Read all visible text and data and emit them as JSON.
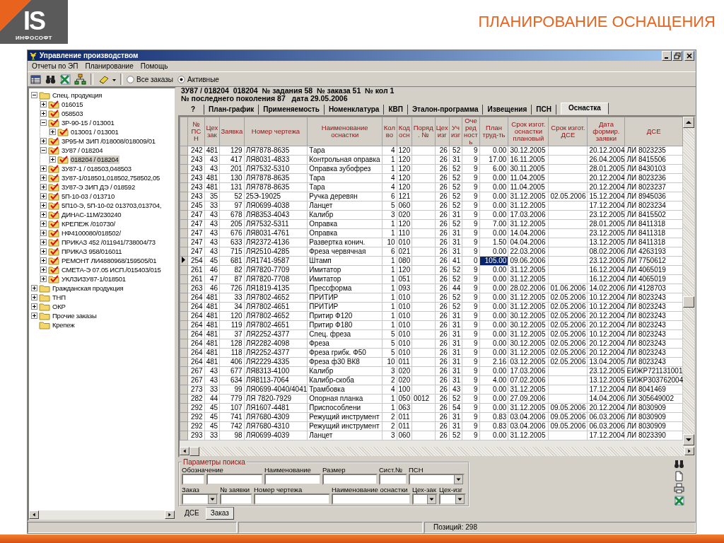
{
  "logo": {
    "mark": "IS",
    "name": "ИНФОСОФТ"
  },
  "page_title": "ПЛАНИРОВАНИЕ ОСНАЩЕНИЯ",
  "window": {
    "title": "Управление производством"
  },
  "menu": [
    "Отчеты по ЭП",
    "Планирование",
    "Помощь"
  ],
  "toolbar": {
    "filters": [
      {
        "label": "Все заказы",
        "selected": false
      },
      {
        "label": "Активные",
        "selected": true
      }
    ]
  },
  "tree": {
    "items": [
      {
        "label": "Спец. продукция",
        "kind": "folder",
        "expanded": true,
        "selected": false,
        "children": [
          {
            "label": "016015",
            "kind": "order",
            "expanded": false,
            "selected": false
          },
          {
            "label": "058503",
            "kind": "order",
            "expanded": false,
            "selected": false
          },
          {
            "label": "3Р-90-15 / 013001",
            "kind": "order",
            "expanded": true,
            "selected": false,
            "children": [
              {
                "label": "013001 / 013001",
                "kind": "order",
                "expanded": false,
                "selected": false
              }
            ]
          },
          {
            "label": "3Р95-М ЗИП /018008/018009/01",
            "kind": "order",
            "expanded": false,
            "selected": false
          },
          {
            "label": "3У87 / 018204",
            "kind": "order",
            "expanded": true,
            "selected": false,
            "children": [
              {
                "label": "018204 / 018204",
                "kind": "order",
                "expanded": false,
                "selected": true
              }
            ]
          },
          {
            "label": "3У87-1 / 018503,048503",
            "kind": "order",
            "expanded": false,
            "selected": false
          },
          {
            "label": "3У87-1/018501,018502,758502,05",
            "kind": "order",
            "expanded": false,
            "selected": false
          },
          {
            "label": "3У87-Э ЗИП ДЭ / 018592",
            "kind": "order",
            "expanded": false,
            "selected": false
          },
          {
            "label": "5П-10-03 / 013710",
            "kind": "order",
            "expanded": false,
            "selected": false
          },
          {
            "label": "5П10-Э, 5П-10-02 013703,013704,",
            "kind": "order",
            "expanded": false,
            "selected": false
          },
          {
            "label": "ДИНАС-11М/230240",
            "kind": "order",
            "expanded": false,
            "selected": false
          },
          {
            "label": "КРЕПЕЖ /010730/",
            "kind": "order",
            "expanded": false,
            "selected": false
          },
          {
            "label": "НФ4100080/018502/",
            "kind": "order",
            "expanded": false,
            "selected": false
          },
          {
            "label": "ПРИКАЗ 452 /011941/738004/73",
            "kind": "order",
            "expanded": false,
            "selected": false
          },
          {
            "label": "ПРИКАЗ 958/016011",
            "kind": "order",
            "expanded": false,
            "selected": false
          },
          {
            "label": "РЕМОНТ ЛИ4880968/159505/01",
            "kind": "order",
            "expanded": false,
            "selected": false
          },
          {
            "label": "СМЕТА-Э 07.05 ИСП./015403/015",
            "kind": "order",
            "expanded": false,
            "selected": false
          },
          {
            "label": "УКЛЗИЗУ87-1/018501",
            "kind": "order",
            "expanded": false,
            "selected": false
          }
        ]
      },
      {
        "label": "Гражданская продукция",
        "kind": "folder",
        "expanded": false,
        "selected": false
      },
      {
        "label": "ТНП",
        "kind": "folder",
        "expanded": false,
        "selected": false
      },
      {
        "label": "ОКР",
        "kind": "folder",
        "expanded": false,
        "selected": false
      },
      {
        "label": "Прочие заказы",
        "kind": "folder",
        "expanded": false,
        "selected": false
      },
      {
        "label": "Крепеж",
        "kind": "folder",
        "selected": false
      }
    ]
  },
  "info_lines": [
    "3У87 / 018204  018204  № задания 58  № заказа 51  № кол 1",
    "№ последнего поколения 87   дата 29.05.2006"
  ],
  "tabs": [
    {
      "label": "?",
      "selected": false
    },
    {
      "label": "План-график",
      "selected": false
    },
    {
      "label": "Применяемость",
      "selected": false
    },
    {
      "label": "Номенклатура",
      "selected": false
    },
    {
      "label": "КВП",
      "selected": false
    },
    {
      "label": "Эталон-программа",
      "selected": false
    },
    {
      "label": "Извещения",
      "selected": false
    },
    {
      "label": "ПСН",
      "selected": false
    },
    {
      "label": "Оснастка",
      "selected": true
    }
  ],
  "table": {
    "columns": [
      "№ ПСН",
      "Цех зак",
      "Заявка",
      "Номер чертежа",
      "Наименование оснастки",
      "Кол во",
      "Код осн",
      "Поряд. №",
      "Цех изг",
      "Уч изг",
      "Оче ред ность",
      "План труд-ть",
      "Срок изгот. оснастки плановый",
      "Срок изгот. ДСЕ",
      "Дата формир. заявки",
      "ДСЕ"
    ],
    "rows": [
      {
        "selected": false,
        "cells": [
          "242",
          "481",
          "129",
          "ЛЯ7878-8635",
          "Тара",
          "4",
          "120",
          null,
          "26",
          "52",
          "9",
          "0.00",
          "30.12.2005",
          null,
          "20.12.2004",
          "ЛИ 8023235"
        ]
      },
      {
        "selected": false,
        "cells": [
          "243",
          "43",
          "417",
          "ЛЯ8031-4833",
          "Контрольная оправка",
          "1",
          "120",
          null,
          "26",
          "31",
          "9",
          "17.00",
          "16.11.2005",
          null,
          "26.04.2005",
          "ЛИ 8415506"
        ]
      },
      {
        "selected": false,
        "cells": [
          "243",
          "43",
          "201",
          "ЛЯ7532-5310",
          "Оправка зубофрез",
          "1",
          "120",
          null,
          "26",
          "52",
          "9",
          "6.00",
          "30.11.2005",
          null,
          "28.01.2005",
          "ЛИ 8430103"
        ]
      },
      {
        "selected": false,
        "cells": [
          "243",
          "481",
          "130",
          "ЛЯ7878-8635",
          "Тара",
          "4",
          "120",
          null,
          "26",
          "52",
          "9",
          "0.00",
          "11.04.2005",
          null,
          "20.12.2004",
          "ЛИ 8023236"
        ]
      },
      {
        "selected": false,
        "cells": [
          "243",
          "481",
          "131",
          "ЛЯ7878-8635",
          "Тара",
          "4",
          "120",
          null,
          "26",
          "52",
          "9",
          "0.00",
          "11.04.2005",
          null,
          "20.12.2004",
          "ЛИ 8023237"
        ]
      },
      {
        "selected": false,
        "cells": [
          "243",
          "35",
          "52",
          "25Э-19025",
          "Ручка деревян",
          "6",
          "121",
          null,
          "26",
          "52",
          "9",
          "0.00",
          "31.12.2005",
          "02.05.2006",
          "15.12.2004",
          "ЛИ 8945036"
        ]
      },
      {
        "selected": false,
        "cells": [
          "245",
          "33",
          "97",
          "ЛЯ0699-4038",
          "Ланцет",
          "5",
          "060",
          null,
          "26",
          "52",
          "9",
          "0.00",
          "31.12.2005",
          null,
          "17.12.2004",
          "ЛИ 8023234"
        ]
      },
      {
        "selected": false,
        "cells": [
          "247",
          "43",
          "678",
          "ЛЯ8353-4043",
          "Калибр",
          "3",
          "020",
          null,
          "26",
          "31",
          "9",
          "0.00",
          "17.03.2006",
          null,
          "23.12.2005",
          "ЛИ 8415502"
        ]
      },
      {
        "selected": false,
        "cells": [
          "247",
          "43",
          "205",
          "ЛЯ7532-5311",
          "Оправка",
          "1",
          "120",
          null,
          "26",
          "52",
          "9",
          "7.00",
          "31.12.2005",
          null,
          "28.01.2005",
          "ЛИ 8411318"
        ]
      },
      {
        "selected": false,
        "cells": [
          "247",
          "43",
          "676",
          "ЛЯ8031-4761",
          "Оправка",
          "1",
          "110",
          null,
          "26",
          "31",
          "9",
          "0.00",
          "14.04.2006",
          null,
          "23.12.2005",
          "ЛИ 8411318"
        ]
      },
      {
        "selected": false,
        "cells": [
          "247",
          "43",
          "633",
          "ЛЯ2372-4136",
          "Развертка  конич.",
          "10",
          "010",
          null,
          "26",
          "31",
          "9",
          "1.50",
          "04.04.2006",
          null,
          "13.12.2005",
          "ЛИ 8411318"
        ]
      },
      {
        "selected": false,
        "cells": [
          "247",
          "43",
          "715",
          "ЛЯ2510-4285",
          "Фреза червячная",
          "6",
          "021",
          null,
          "26",
          "31",
          "9",
          "0.00",
          "22.03.2006",
          null,
          "08.02.2006",
          "ЛИ 4263193"
        ]
      },
      {
        "selected": true,
        "cells": [
          "254",
          "45",
          "681",
          "ЛЯ1741-9587",
          "Штамп",
          "1",
          "080",
          null,
          "26",
          "41",
          "0",
          {
            "text": "105.00",
            "selected": true
          },
          "09.06.2006",
          null,
          "23.12.2005",
          "ЛИ 7750612"
        ]
      },
      {
        "selected": false,
        "cells": [
          "261",
          "46",
          "82",
          "ЛЯ7820-7709",
          "Имитатор",
          "1",
          "120",
          null,
          "26",
          "52",
          "9",
          "0.00",
          "31.12.2005",
          null,
          "16.12.2004",
          "ЛИ 4065019"
        ]
      },
      {
        "selected": false,
        "cells": [
          "261",
          "47",
          "87",
          "ЛЯ7820-7708",
          "Имитатор",
          "1",
          "051",
          null,
          "26",
          "52",
          "9",
          "0.00",
          "31.12.2005",
          null,
          "16.12.2004",
          "ЛИ 4065019"
        ]
      },
      {
        "selected": false,
        "cells": [
          "263",
          "46",
          "726",
          "ЛЯ1819-4135",
          "Прессформа",
          "1",
          "093",
          null,
          "26",
          "44",
          "9",
          "0.00",
          "28.02.2006",
          "01.06.2006",
          "14.02.2006",
          "ЛИ 4128703"
        ]
      },
      {
        "selected": false,
        "cells": [
          "264",
          "481",
          "33",
          "ЛЯ7802-4652",
          "ПРИТИР",
          "1",
          "010",
          null,
          "26",
          "52",
          "9",
          "0.00",
          "31.12.2005",
          "02.05.2006",
          "10.12.2004",
          "ЛИ 8023243"
        ]
      },
      {
        "selected": false,
        "cells": [
          "264",
          "481",
          "34",
          "ЛЯ7802-4651",
          "ПРИТИР",
          "1",
          "010",
          null,
          "26",
          "52",
          "9",
          "0.00",
          "31.12.2005",
          "02.05.2006",
          "10.12.2004",
          "ЛИ 8023243"
        ]
      },
      {
        "selected": false,
        "cells": [
          "264",
          "481",
          "120",
          "ЛЯ7802-4652",
          "Притир Ф120",
          "1",
          "010",
          null,
          "26",
          "31",
          "9",
          "0.00",
          "30.12.2005",
          "02.05.2006",
          "20.12.2004",
          "ЛИ 8023243"
        ]
      },
      {
        "selected": false,
        "cells": [
          "264",
          "481",
          "119",
          "ЛЯ7802-4651",
          "Притир Ф180",
          "1",
          "010",
          null,
          "26",
          "31",
          "9",
          "0.00",
          "30.12.2005",
          "02.05.2006",
          "20.12.2004",
          "ЛИ 8023243"
        ]
      },
      {
        "selected": false,
        "cells": [
          "264",
          "481",
          "37",
          "ЛЯ2252-4377",
          "Спец. фреза",
          "5",
          "010",
          null,
          "26",
          "31",
          "9",
          "0.00",
          "31.12.2005",
          "02.05.2006",
          "10.12.2004",
          "ЛИ 8023243"
        ]
      },
      {
        "selected": false,
        "cells": [
          "264",
          "481",
          "128",
          "ЛЯ2282-4098",
          "Фреза",
          "5",
          "010",
          null,
          "26",
          "31",
          "9",
          "0.00",
          "30.12.2005",
          "02.05.2006",
          "20.12.2004",
          "ЛИ 8023243"
        ]
      },
      {
        "selected": false,
        "cells": [
          "264",
          "481",
          "118",
          "ЛЯ2252-4377",
          "Фреза грибк. Ф50",
          "5",
          "010",
          null,
          "26",
          "31",
          "9",
          "0.00",
          "31.12.2005",
          "02.05.2006",
          "20.12.2004",
          "ЛИ 8023243"
        ]
      },
      {
        "selected": false,
        "cells": [
          "264",
          "481",
          "406",
          "ЛЯ2229-4335",
          "Фреза ф30 ВК8",
          "10",
          "011",
          null,
          "26",
          "31",
          "9",
          "2.16",
          "03.12.2005",
          "02.05.2006",
          "13.04.2005",
          "ЛИ 8023243"
        ]
      },
      {
        "selected": false,
        "cells": [
          "267",
          "43",
          "677",
          "ЛЯ8313-4100",
          "Калибр",
          "3",
          "020",
          null,
          "26",
          "31",
          "9",
          "0.00",
          "17.03.2006",
          null,
          "23.12.2005",
          "ЕИЖР721131001"
        ]
      },
      {
        "selected": false,
        "cells": [
          "267",
          "43",
          "634",
          "ЛЯ8113-7064",
          "Калибр-скоба",
          "2",
          "020",
          null,
          "26",
          "31",
          "9",
          "4.00",
          "07.02.2006",
          null,
          "13.12.2005",
          "ЕИЖР303762004"
        ]
      },
      {
        "selected": false,
        "cells": [
          "273",
          "33",
          "99",
          "ЛЯ0699-4040/4041",
          "Трамбовка",
          "4",
          "100",
          null,
          "26",
          "43",
          "9",
          "0.00",
          "31.12.2005",
          null,
          "17.12.2004",
          "ЛИ 8041469"
        ]
      },
      {
        "selected": false,
        "cells": [
          "282",
          "44",
          "779",
          "ЛЯ 7820-7929",
          "Опорная планка",
          "1",
          "050",
          "0012",
          "26",
          "52",
          "9",
          "0.00",
          "27.09.2006",
          null,
          "14.04.2006",
          "ЛИ 305649002"
        ]
      },
      {
        "selected": false,
        "cells": [
          "292",
          "45",
          "107",
          "ЛЯ1607-4481",
          "Приспособлени",
          "1",
          "063",
          null,
          "26",
          "54",
          "9",
          "0.00",
          "31.12.2005",
          "09.05.2006",
          "20.12.2004",
          "ЛИ 8030909"
        ]
      },
      {
        "selected": false,
        "cells": [
          "292",
          "45",
          "741",
          "ЛЯ7680-4309",
          "Режущий инструмент",
          "2",
          "011",
          null,
          "26",
          "31",
          "9",
          "0.83",
          "03.04.2006",
          "09.05.2006",
          "06.03.2006",
          "ЛИ 8030909"
        ]
      },
      {
        "selected": false,
        "cells": [
          "292",
          "45",
          "742",
          "ЛЯ7680-4310",
          "Режущий инструмент",
          "2",
          "011",
          null,
          "26",
          "31",
          "9",
          "0.83",
          "03.04.2006",
          "09.05.2006",
          "06.03.2006",
          "ЛИ 8030909"
        ]
      },
      {
        "selected": false,
        "cells": [
          "293",
          "33",
          "98",
          "ЛЯ0699-4039",
          "Ланцет",
          "3",
          "060",
          null,
          "26",
          "52",
          "9",
          "0.00",
          "31.12.2005",
          null,
          "17.12.2004",
          "ЛИ 8023390"
        ]
      }
    ]
  },
  "search": {
    "title": "Параметры поиска",
    "line_1": [
      {
        "label": "Обозначение",
        "kind": "input"
      },
      {
        "kind": "input"
      },
      {
        "label": "Наименование",
        "kind": "input"
      },
      {
        "label": "Размер",
        "kind": "input"
      },
      {
        "label": "Сист.№",
        "kind": "input"
      },
      {
        "label": "ПСН",
        "kind": "select"
      }
    ],
    "line_2": [
      {
        "label": "Заказ",
        "kind": "select"
      },
      {
        "label": "№ заявки",
        "kind": "input"
      },
      {
        "label": "Номер чертежа",
        "kind": "input"
      },
      {
        "label": "Наименование оснастки",
        "kind": "input"
      },
      {
        "label": "Цех-зак",
        "kind": "select"
      },
      {
        "label": "Цех-изг",
        "kind": "select"
      }
    ]
  },
  "bottom_tabs": [
    {
      "label": "ДСЕ",
      "selected": false
    },
    {
      "label": "Заказ",
      "selected": true
    }
  ],
  "status_bar": {
    "text": "Позиций: 298"
  }
}
